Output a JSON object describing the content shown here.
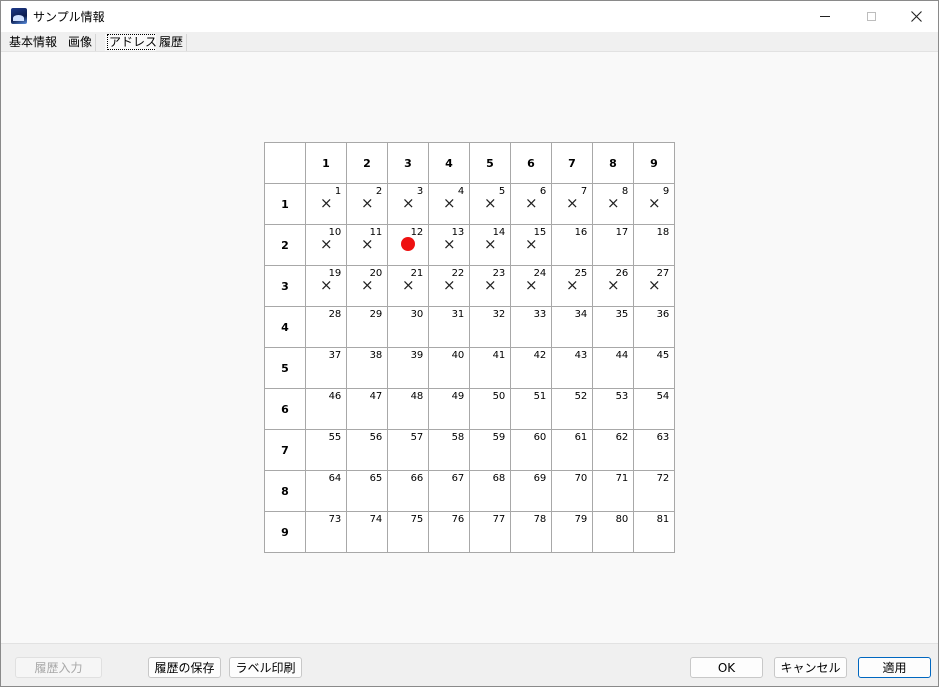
{
  "window": {
    "title": "サンプル情報",
    "minimize_icon": "minimize-icon",
    "maximize_icon": "maximize-icon",
    "close_icon": "close-icon"
  },
  "tabs": [
    {
      "label": "基本情報"
    },
    {
      "label": "画像"
    },
    {
      "label": "アドレス",
      "active": true
    },
    {
      "label": "履歴"
    }
  ],
  "grid": {
    "column_headers": [
      "1",
      "2",
      "3",
      "4",
      "5",
      "6",
      "7",
      "8",
      "9"
    ],
    "row_headers": [
      "1",
      "2",
      "3",
      "4",
      "5",
      "6",
      "7",
      "8",
      "9"
    ],
    "cell_numbers": [
      [
        "1",
        "2",
        "3",
        "4",
        "5",
        "6",
        "7",
        "8",
        "9"
      ],
      [
        "10",
        "11",
        "12",
        "13",
        "14",
        "15",
        "16",
        "17",
        "18"
      ],
      [
        "19",
        "20",
        "21",
        "22",
        "23",
        "24",
        "25",
        "26",
        "27"
      ],
      [
        "28",
        "29",
        "30",
        "31",
        "32",
        "33",
        "34",
        "35",
        "36"
      ],
      [
        "37",
        "38",
        "39",
        "40",
        "41",
        "42",
        "43",
        "44",
        "45"
      ],
      [
        "46",
        "47",
        "48",
        "49",
        "50",
        "51",
        "52",
        "53",
        "54"
      ],
      [
        "55",
        "56",
        "57",
        "58",
        "59",
        "60",
        "61",
        "62",
        "63"
      ],
      [
        "64",
        "65",
        "66",
        "67",
        "68",
        "69",
        "70",
        "71",
        "72"
      ],
      [
        "73",
        "74",
        "75",
        "76",
        "77",
        "78",
        "79",
        "80",
        "81"
      ]
    ],
    "marks": [
      [
        "x",
        "x",
        "x",
        "x",
        "x",
        "x",
        "x",
        "x",
        "x"
      ],
      [
        "x",
        "x",
        "dot",
        "x",
        "x",
        "x",
        "",
        "",
        ""
      ],
      [
        "x",
        "x",
        "x",
        "x",
        "x",
        "x",
        "x",
        "x",
        "x"
      ],
      [
        "",
        "",
        "",
        "",
        "",
        "",
        "",
        "",
        ""
      ],
      [
        "",
        "",
        "",
        "",
        "",
        "",
        "",
        "",
        ""
      ],
      [
        "",
        "",
        "",
        "",
        "",
        "",
        "",
        "",
        ""
      ],
      [
        "",
        "",
        "",
        "",
        "",
        "",
        "",
        "",
        ""
      ],
      [
        "",
        "",
        "",
        "",
        "",
        "",
        "",
        "",
        ""
      ],
      [
        "",
        "",
        "",
        "",
        "",
        "",
        "",
        "",
        ""
      ]
    ],
    "x_symbol": "×",
    "dot_color": "#ee1111"
  },
  "footer": {
    "history_input": "履歴入力",
    "save_history": "履歴の保存",
    "label_print": "ラベル印刷",
    "ok": "OK",
    "cancel": "キャンセル",
    "apply": "適用"
  }
}
